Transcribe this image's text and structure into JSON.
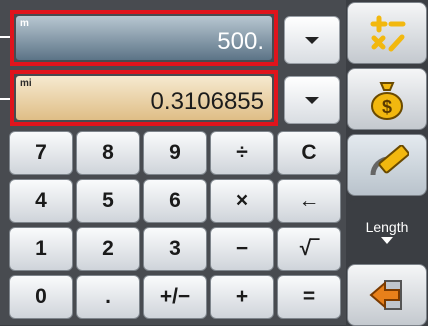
{
  "display": {
    "row1": {
      "unit": "m",
      "value": "500."
    },
    "row2": {
      "unit": "mi",
      "value": "0.3106855"
    }
  },
  "keypad": [
    [
      "7",
      "8",
      "9",
      "÷",
      "C"
    ],
    [
      "4",
      "5",
      "6",
      "×",
      "←"
    ],
    [
      "1",
      "2",
      "3",
      "−",
      "√‾"
    ],
    [
      "0",
      ".",
      "+/−",
      "+",
      "="
    ]
  ],
  "sidebar": {
    "mode_label": "Length"
  },
  "colors": {
    "highlight_border": "#e0141c",
    "display1_bg": "#7f97a8",
    "display2_bg": "#e8cf9c",
    "accent_yellow": "#f2b80f",
    "accent_orange": "#e8801a"
  },
  "icons": {
    "dropdown": "chevron-down-icon",
    "operations": "calculator-operations-icon",
    "currency": "money-bag-icon",
    "conversion": "ruler-icon",
    "back": "back-arrow-icon"
  }
}
